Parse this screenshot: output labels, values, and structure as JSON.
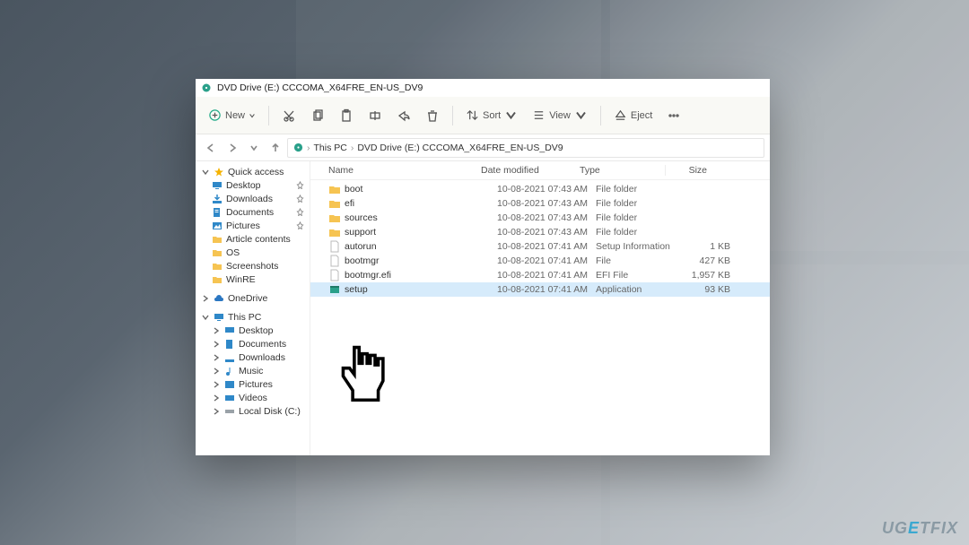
{
  "window": {
    "title": "DVD Drive (E:) CCCOMA_X64FRE_EN-US_DV9"
  },
  "toolbar": {
    "new_label": "New",
    "sort_label": "Sort",
    "view_label": "View",
    "eject_label": "Eject"
  },
  "breadcrumbs": {
    "root": "This PC",
    "current": "DVD Drive (E:) CCCOMA_X64FRE_EN-US_DV9"
  },
  "columns": {
    "name": "Name",
    "date": "Date modified",
    "type": "Type",
    "size": "Size"
  },
  "navtree": {
    "quick_access": "Quick access",
    "desktop": "Desktop",
    "downloads": "Downloads",
    "documents": "Documents",
    "pictures": "Pictures",
    "article_contents": "Article contents",
    "os": "OS",
    "screenshots": "Screenshots",
    "winre": "WinRE",
    "onedrive": "OneDrive",
    "this_pc": "This PC",
    "pc_desktop": "Desktop",
    "pc_documents": "Documents",
    "pc_downloads": "Downloads",
    "pc_music": "Music",
    "pc_pictures": "Pictures",
    "pc_videos": "Videos",
    "pc_localdisk": "Local Disk (C:)"
  },
  "files": [
    {
      "name": "boot",
      "date": "10-08-2021 07:43 AM",
      "type": "File folder",
      "size": "",
      "icon": "folder"
    },
    {
      "name": "efi",
      "date": "10-08-2021 07:43 AM",
      "type": "File folder",
      "size": "",
      "icon": "folder"
    },
    {
      "name": "sources",
      "date": "10-08-2021 07:43 AM",
      "type": "File folder",
      "size": "",
      "icon": "folder"
    },
    {
      "name": "support",
      "date": "10-08-2021 07:43 AM",
      "type": "File folder",
      "size": "",
      "icon": "folder"
    },
    {
      "name": "autorun",
      "date": "10-08-2021 07:41 AM",
      "type": "Setup Information",
      "size": "1 KB",
      "icon": "file"
    },
    {
      "name": "bootmgr",
      "date": "10-08-2021 07:41 AM",
      "type": "File",
      "size": "427 KB",
      "icon": "file"
    },
    {
      "name": "bootmgr.efi",
      "date": "10-08-2021 07:41 AM",
      "type": "EFI File",
      "size": "1,957 KB",
      "icon": "file"
    },
    {
      "name": "setup",
      "date": "10-08-2021 07:41 AM",
      "type": "Application",
      "size": "93 KB",
      "icon": "app",
      "selected": true
    }
  ],
  "watermark": {
    "prefix": "UG",
    "highlight": "E",
    "suffix": "TFIX"
  }
}
